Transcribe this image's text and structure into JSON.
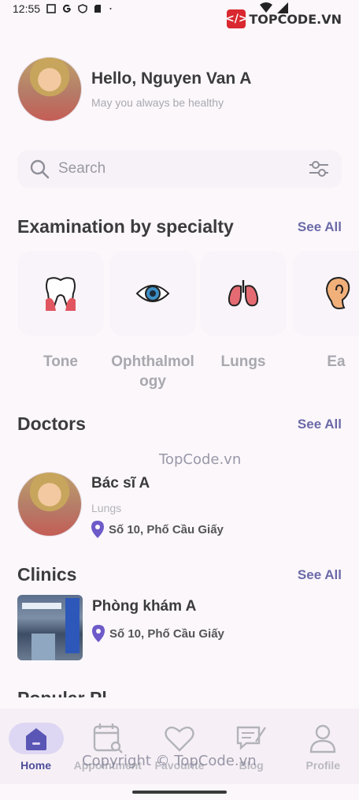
{
  "status_bar": {
    "time": "12:55"
  },
  "watermark": {
    "logo_text": "TOPCODE.VN",
    "center": "TopCode.vn",
    "bottom": "Copyright © TopCode.vn"
  },
  "header": {
    "greeting": "Hello, Nguyen Van A",
    "subtitle": "May you always be healthy"
  },
  "search": {
    "placeholder": "Search"
  },
  "specialty": {
    "title": "Examination by specialty",
    "see_all": "See All",
    "items": [
      {
        "label": "Tone",
        "icon": "tooth-icon"
      },
      {
        "label": "Ophthalmol ogy",
        "icon": "eye-icon"
      },
      {
        "label": "Lungs",
        "icon": "lungs-icon"
      },
      {
        "label": "Ea",
        "icon": "ear-icon"
      }
    ]
  },
  "doctors": {
    "title": "Doctors",
    "see_all": "See All",
    "items": [
      {
        "name": "Bác sĩ A",
        "specialty": "Lungs",
        "address": "Số 10, Phố Cầu Giấy"
      }
    ]
  },
  "clinics": {
    "title": "Clinics",
    "see_all": "See All",
    "items": [
      {
        "name": "Phòng khám A",
        "address": "Số 10, Phố Cầu Giấy"
      }
    ]
  },
  "partial_section": {
    "title": "Popular Pl"
  },
  "nav": {
    "items": [
      {
        "label": "Home",
        "icon": "home-icon",
        "active": true
      },
      {
        "label": "Appointment",
        "icon": "calendar-icon",
        "active": false
      },
      {
        "label": "Favourite",
        "icon": "heart-icon",
        "active": false
      },
      {
        "label": "Blog",
        "icon": "blog-icon",
        "active": false
      },
      {
        "label": "Profile",
        "icon": "profile-icon",
        "active": false
      }
    ]
  },
  "colors": {
    "accent": "#6b6aa8",
    "nav_active_bg": "#ddd7f3",
    "pin": "#6e5bc9"
  }
}
